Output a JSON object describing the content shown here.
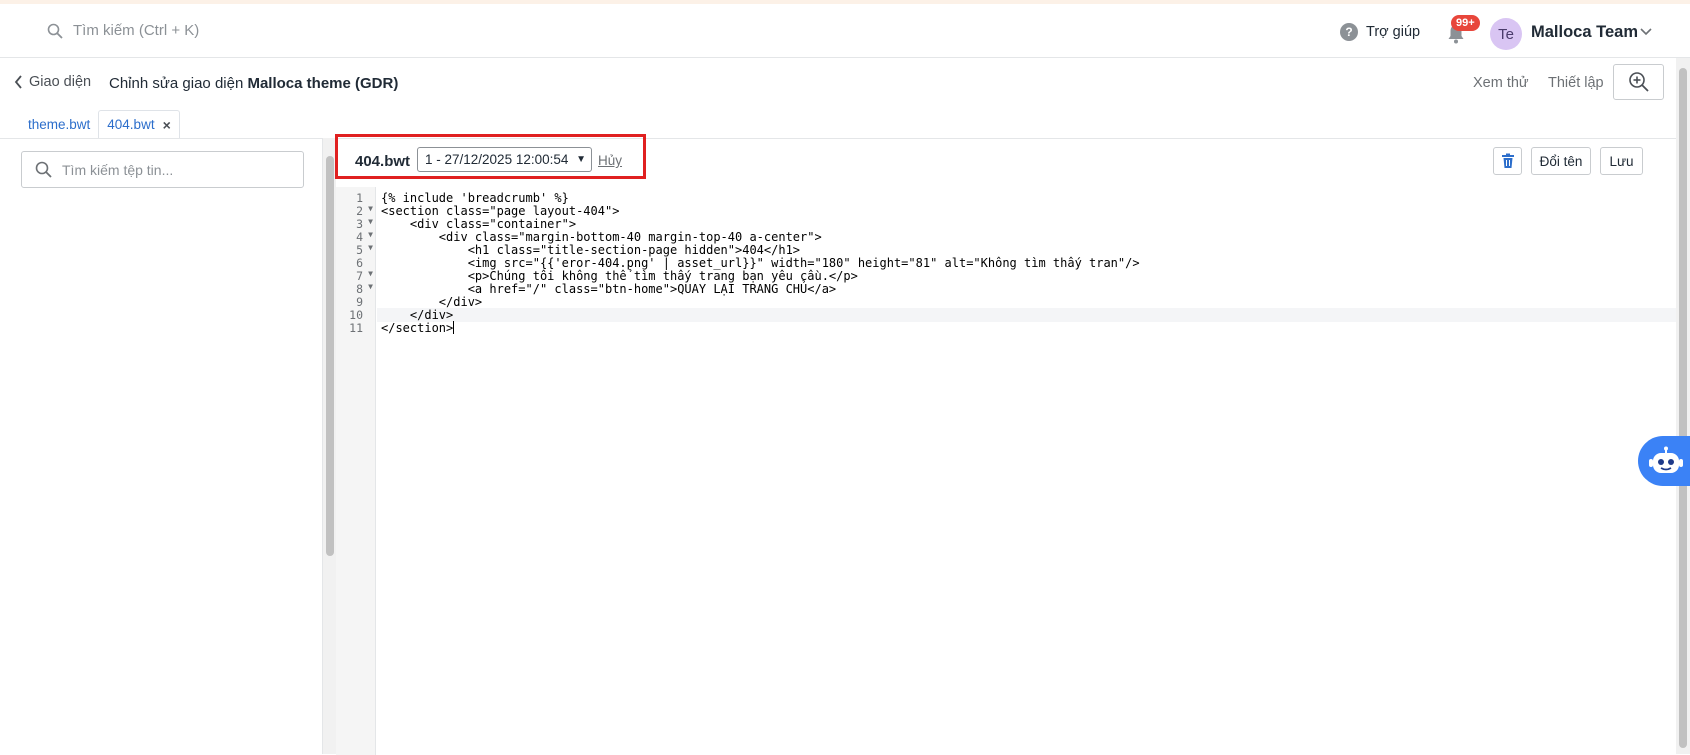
{
  "header": {
    "search_placeholder": "Tìm kiếm (Ctrl + K)",
    "help_label": "Trợ giúp",
    "notification_count": "99+",
    "avatar_initials": "Te",
    "team_name": "Malloca Team"
  },
  "subheader": {
    "back_label": "Giao diện",
    "title_prefix": "Chỉnh sửa giao diện",
    "title_theme": "Malloca theme (GDR)",
    "preview_label": "Xem thử",
    "settings_label": "Thiết lập"
  },
  "file_tabs": [
    {
      "label": "theme.bwt"
    },
    {
      "label": "404.bwt"
    }
  ],
  "sidebar": {
    "file_search_placeholder": "Tìm kiếm tệp tin..."
  },
  "editor": {
    "file_name": "404.bwt",
    "version_selected": "1 - 27/12/2025 12:00:54",
    "cancel_label": "Hủy",
    "rename_label": "Đổi tên",
    "save_label": "Lưu",
    "line_numbers": [
      "1",
      "2",
      "3",
      "4",
      "5",
      "6",
      "7",
      "8",
      "9",
      "10",
      "11"
    ],
    "code_lines": [
      "{% include 'breadcrumb' %}",
      "<section class=\"page layout-404\">",
      "    <div class=\"container\">",
      "        <div class=\"margin-bottom-40 margin-top-40 a-center\">",
      "            <h1 class=\"title-section-page hidden\">404</h1>",
      "            <img src=\"{{'eror-404.png' | asset_url}}\" width=\"180\" height=\"81\" alt=\"Không tìm thấy tran\"/>",
      "            <p>Chúng tôi không thể tìm thấy trang bạn yêu cầu.</p>",
      "            <a href=\"/\" class=\"btn-home\">QUAY LẠI TRANG CHỦ</a>",
      "        </div>",
      "    </div>",
      "</section>"
    ]
  },
  "colors": {
    "accent_link": "#2c6ecb",
    "highlight_box": "#e02020",
    "badge": "#e8463b",
    "bot": "#3b82f6"
  }
}
